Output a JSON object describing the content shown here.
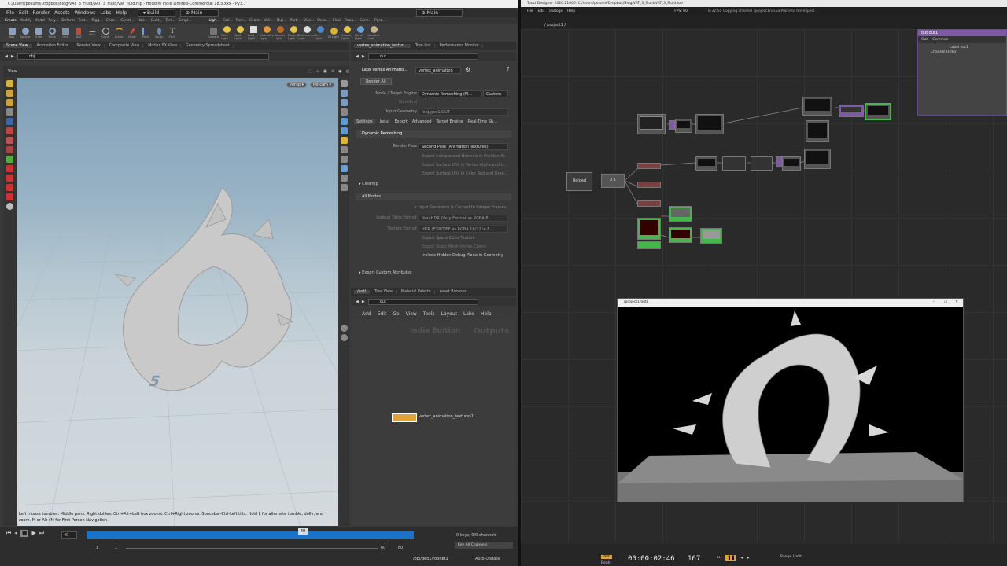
{
  "houdini": {
    "title": "C:/Users/pesumi/Dropbox/Blog/VAT_3_Fluid/VAT_3_Fluid/vat_fluid.hip - Houdini Indie Limited-Commercial 18.5.xxx - Py3.7",
    "menu": [
      "File",
      "Edit",
      "Render",
      "Assets",
      "Windows",
      "Labs",
      "Help"
    ],
    "desktop": "Build",
    "main_label": "Main",
    "shelf_tabs": [
      "Create",
      "Modify",
      "Model",
      "Poly...",
      "Deform",
      "Text...",
      "Rigg...",
      "Char...",
      "Const...",
      "Hair...",
      "Guid...",
      "Terr...",
      "Simpl..."
    ],
    "shelf_tools": [
      "Box",
      "Sphere",
      "Tube",
      "Torus",
      "Grid",
      "Null",
      "Line",
      "Circle",
      "Curve",
      "Draw",
      "Path",
      "Spray",
      "Font"
    ],
    "right_shelf_tabs": [
      "Ligh...",
      "Coll...",
      "Part...",
      "Grains",
      "Vell...",
      "Rigi...",
      "Part...",
      "Visc...",
      "Ocea...",
      "Fluid",
      "Popu...",
      "Cont...",
      "Pyro..."
    ],
    "right_shelf_tools": [
      "Camera",
      "Point Light",
      "Spot Light",
      "Area Light",
      "Geometry Light",
      "Volume Light",
      "Distant Light",
      "Environment Light",
      "Sky Light",
      "GI Light",
      "Caustic Light",
      "Portal Light",
      "Ambient Light"
    ],
    "pane_tabs": [
      "Scene View",
      "Animation Editor",
      "Render View",
      "Composite View",
      "Motion FX View",
      "Geometry Spreadsheet"
    ],
    "path": "obj",
    "view_label": "View",
    "persp": "Persp",
    "nocam": "No cam",
    "status_text": "Left mouse tumbles. Middle pans. Right dollies. Ctrl+Alt+Left box zooms. Ctrl+Right zooms. Spacebar-Ctrl-Left tilts. Hold L for alternate tumble, dolly, and zoom.    M or Alt+M for First Person Navigation.",
    "frame": "40",
    "start": "1",
    "start2": "1",
    "end": "60",
    "end2": "60",
    "keys": "0 keys, 0/0 channels",
    "key_all": "Key All Channels",
    "obj_path": "/obj/geo1/ropnet1",
    "auto_update": "Auto Update",
    "ground_num": "5"
  },
  "params": {
    "node_tab": "vertex_animation_textur...",
    "tree_tab": "Tree List",
    "perf_tab": "Performance Monitor",
    "path": "out",
    "node_type": "Labs Vertex Animatio...",
    "node_name": "vertex_animation",
    "render_all": "Render All",
    "mode_label": "Mode / Target Engine",
    "mode_value": "Dynamic Remeshing (Fl...",
    "engine_value": "Custom",
    "start_end": "Start/End",
    "input_geo_label": "Input Geometry",
    "input_geo_value": "/obj/geo1/OUT",
    "tabs": [
      "Settings",
      "Input",
      "Export",
      "Advanced",
      "Target Engine",
      "Real-Time Sh..."
    ],
    "dyn_title": "Dynamic Remeshing",
    "render_pass_label": "Render Pass",
    "render_pass_value": "Second Pass (Animation Textures)",
    "opt1": "Export Compressed Normals in Position Al...",
    "opt2": "Export Surface UVs in Vertex Alpha and U...",
    "opt3": "Export Surface UVs in Color Red and Gree...",
    "cleanup": "Cleanup",
    "all_modes": "All Modes",
    "opt4": "Input Geometry is Cached to Integer Frames",
    "lookup_label": "Lookup Table Format",
    "lookup_value": "Non-HDR (Very Format as RGBA 8...",
    "texture_label": "Texture Format",
    "texture_value": "HDR (EXR/TIFF as RGBA 16/32 in E...",
    "opt5": "Export Space Color Texture",
    "opt6": "Export Static Mesh Vertex Colors",
    "opt7": "Include Hidden Debug Plane in Geometry",
    "export_custom": "Export Custom Attributes"
  },
  "netview": {
    "tabs": [
      "/out/",
      "Tree View",
      "Material Palette",
      "Asset Browser"
    ],
    "path": "out",
    "menu": [
      "Add",
      "Edit",
      "Go",
      "View",
      "Tools",
      "Layout",
      "Labs",
      "Help"
    ],
    "watermark1": "Indie Edition",
    "watermark2": "Outputs",
    "node_label": "vertex_animation_textures1"
  },
  "td": {
    "title": "TouchDesigner 2020.21000: C:/Users/pesumi/Dropbox/Blog/VAT_3_Fluid/VAT_3_Fluid.toe",
    "menu": [
      "File",
      "Edit",
      "Dialogs",
      "Help"
    ],
    "fps_readout": "FPS: 60",
    "status": "8:32:50 Copying channel /project1/visualPlane to file export.",
    "path": "/ project1 / ",
    "reload": "Reload",
    "null_label": "0 1",
    "out_title": "/project1/out1",
    "panel_title": "out1",
    "panel_tabs": [
      "Out",
      "Common"
    ],
    "panel_label": "Label",
    "panel_label_value": "out1",
    "panel_render_label": "Channel Order",
    "timecode": "00:00:02:46",
    "frame": "167",
    "range": "Range Limit",
    "realtime": "Real",
    "beat": "Beats"
  },
  "colors": {
    "accent_orange": "#e0a33a",
    "timeline_blue": "#1a73c9",
    "td_purple": "#7e5aa6",
    "td_green": "#45b64a"
  }
}
